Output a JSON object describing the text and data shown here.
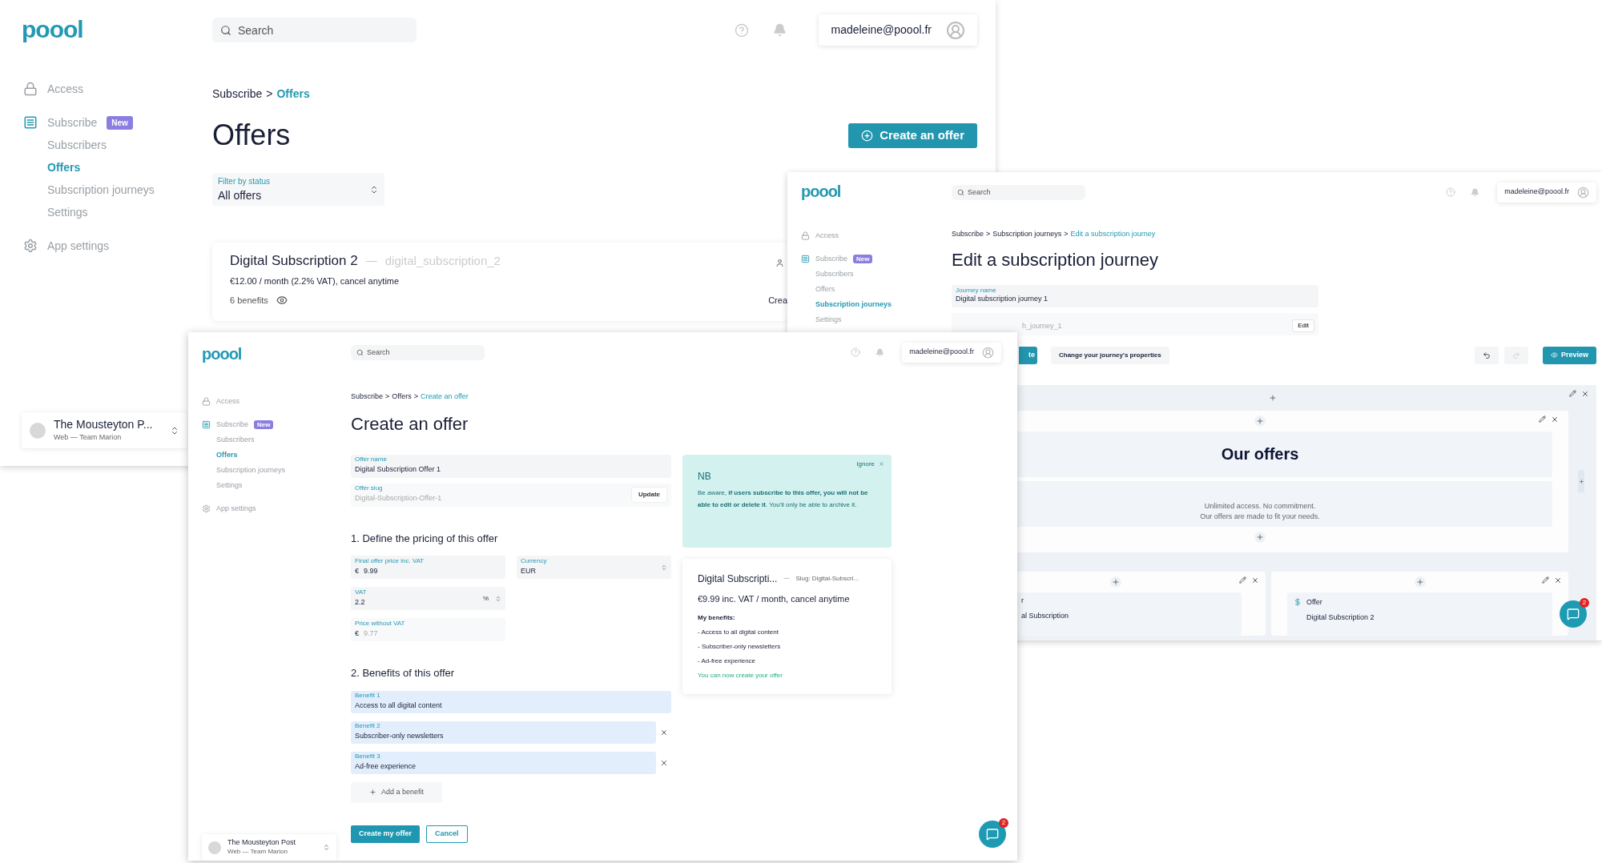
{
  "offers_window": {
    "logo": "poool",
    "search": {
      "placeholder": "Search"
    },
    "user": "madeleine@poool.fr",
    "sidebar": [
      {
        "label": "Access",
        "selected": false
      },
      {
        "label": "Subscribe",
        "badge": "New",
        "selected": false,
        "children": [
          {
            "label": "Subscribers",
            "selected": false
          },
          {
            "label": "Offers",
            "selected": true
          },
          {
            "label": "Subscription journeys",
            "selected": false
          },
          {
            "label": "Settings",
            "selected": false
          }
        ]
      },
      {
        "label": "App settings",
        "selected": false
      }
    ],
    "workspace": {
      "name": "The Mousteyton P...",
      "detail": "Web — Team Marion"
    },
    "breadcrumb": {
      "separator": ">",
      "items": [
        {
          "label": "Subscribe",
          "selected": false
        },
        {
          "label": "Offers",
          "selected": true
        }
      ]
    },
    "title": "Offers",
    "create_button": "Create an offer",
    "filter": {
      "label": "Filter by status",
      "value": "All offers"
    },
    "offer_card": {
      "name": "Digital Subscription 2",
      "dash": "—",
      "slug": "digital_subscription_2",
      "price": "€12.00 / month (2.2% VAT), cancel anytime",
      "benefits": "6 benefits",
      "cut_text": "Crea"
    }
  },
  "journey_window": {
    "logo": "poool",
    "search": {
      "placeholder": "Search"
    },
    "user": "madeleine@poool.fr",
    "sidebar": [
      {
        "label": "Access",
        "selected": false
      },
      {
        "label": "Subscribe",
        "badge": "New",
        "selected": false,
        "children": [
          {
            "label": "Subscribers",
            "selected": false
          },
          {
            "label": "Offers",
            "selected": false
          },
          {
            "label": "Subscription journeys",
            "selected": true
          },
          {
            "label": "Settings",
            "selected": false
          }
        ]
      }
    ],
    "breadcrumb": {
      "separator": ">",
      "items": [
        {
          "label": "Subscribe",
          "selected": false
        },
        {
          "label": "Subscription journeys",
          "selected": false
        },
        {
          "label": "Edit a subscription journey",
          "selected": true
        }
      ]
    },
    "title": "Edit a subscription journey",
    "journey_name": {
      "label": "Journey name",
      "value": "Digital subscription journey 1"
    },
    "journey_slug": {
      "value": "h_journey_1",
      "button": "Edit"
    },
    "save_button": "te",
    "properties_button": "Change your journey's properties",
    "undo": {
      "disabled": false
    },
    "redo": {
      "disabled": true
    },
    "preview_button": "Preview",
    "canvas": {
      "heading": "Our offers",
      "description": [
        "Unlimited access. No commitment.",
        "Our offers are made to fit your needs."
      ],
      "cards": [
        {
          "kind": "cut",
          "lines": [
            "r",
            "al Subscription"
          ]
        },
        {
          "kind": "offer",
          "label": "Offer",
          "name": "Digital Subscription 2"
        }
      ]
    },
    "chat_badge": "2"
  },
  "create_window": {
    "logo": "poool",
    "search": {
      "placeholder": "Search"
    },
    "user": "madeleine@poool.fr",
    "sidebar": [
      {
        "label": "Access",
        "selected": false
      },
      {
        "label": "Subscribe",
        "badge": "New",
        "selected": false,
        "children": [
          {
            "label": "Subscribers",
            "selected": false
          },
          {
            "label": "Offers",
            "selected": true
          },
          {
            "label": "Subscription journeys",
            "selected": false
          },
          {
            "label": "Settings",
            "selected": false
          }
        ]
      },
      {
        "label": "App settings",
        "selected": false
      }
    ],
    "workspace": {
      "name": "The Mousteyton Post",
      "detail": "Web — Team Marion"
    },
    "breadcrumb": {
      "separator": ">",
      "items": [
        {
          "label": "Subscribe",
          "selected": false
        },
        {
          "label": "Offers",
          "selected": false
        },
        {
          "label": "Create an offer",
          "selected": true
        }
      ]
    },
    "title": "Create an offer",
    "offer_name": {
      "label": "Offer name",
      "value": "Digital Subscription Offer 1"
    },
    "offer_slug": {
      "label": "Offer slug",
      "value": "Digital-Subscription-Offer-1",
      "button": "Update"
    },
    "pricing_heading": "1. Define the pricing of this offer",
    "price": {
      "label": "Final offer price inc. VAT",
      "currency_symbol": "€",
      "value": "9.99"
    },
    "currency": {
      "label": "Currency",
      "value": "EUR"
    },
    "vat": {
      "label": "VAT",
      "value": "2.2",
      "unit": "%"
    },
    "price_without_vat": {
      "label": "Price without VAT",
      "currency_symbol": "€",
      "value": "9.77",
      "disabled": true
    },
    "benefits_heading": "2. Benefits of this offer",
    "benefits": [
      {
        "label": "Benefit 1",
        "value": "Access to all digital content",
        "removable": false
      },
      {
        "label": "Benefit 2",
        "value": "Subscriber-only newsletters",
        "removable": true
      },
      {
        "label": "Benefit 3",
        "value": "Ad-free experience",
        "removable": true
      }
    ],
    "add_benefit": "Add a benefit",
    "submit": "Create my offer",
    "cancel": "Cancel",
    "notice": {
      "dismiss": "Ignore",
      "title": "NB",
      "text": "Be aware, **if users subscribe to this offer, you will not be able to edit or delete it**. You'll only be able to archive it."
    },
    "preview": {
      "name": "Digital Subscripti...",
      "dash": "—",
      "slug": "Slug: Digital-Subscri...",
      "price": "€9.99 inc. VAT / month, cancel anytime",
      "benefits_title": "My benefits:",
      "benefits": [
        "- Access to all digital content",
        "- Subscriber-only newsletters",
        "- Ad-free experience"
      ],
      "status": "You can now create your offer"
    },
    "chat_badge": "2"
  }
}
